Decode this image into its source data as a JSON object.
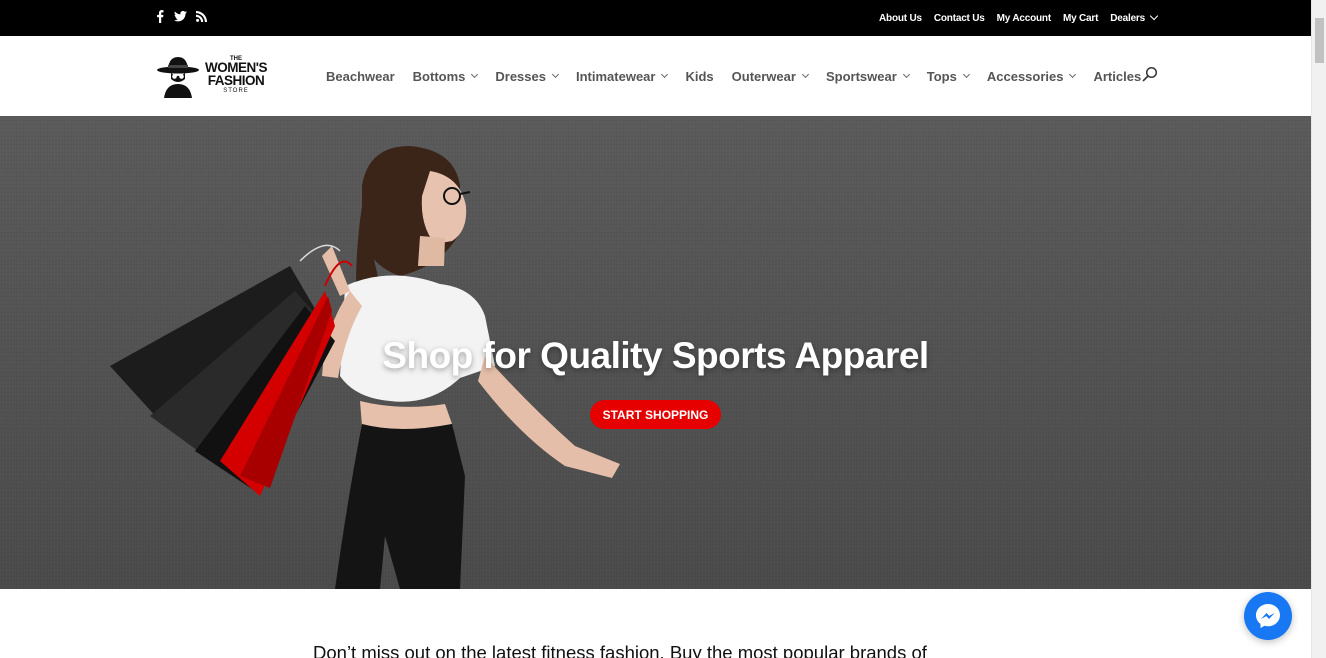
{
  "topbar": {
    "social_icons": [
      "facebook-icon",
      "twitter-icon",
      "rss-icon"
    ],
    "links": [
      {
        "label": "About Us"
      },
      {
        "label": "Contact Us"
      },
      {
        "label": "My Account"
      },
      {
        "label": "My Cart"
      },
      {
        "label": "Dealers"
      }
    ]
  },
  "logo": {
    "line1": "THE",
    "line2": "WOMEN'S",
    "line3": "FASHION",
    "line4": "STORE"
  },
  "nav": {
    "items": [
      {
        "label": "Beachwear",
        "dropdown": false
      },
      {
        "label": "Bottoms",
        "dropdown": true
      },
      {
        "label": "Dresses",
        "dropdown": true
      },
      {
        "label": "Intimatewear",
        "dropdown": true
      },
      {
        "label": "Kids",
        "dropdown": false
      },
      {
        "label": "Outerwear",
        "dropdown": true
      },
      {
        "label": "Sportswear",
        "dropdown": true
      },
      {
        "label": "Tops",
        "dropdown": true
      },
      {
        "label": "Accessories",
        "dropdown": true
      },
      {
        "label": "Articles",
        "dropdown": false
      }
    ],
    "search_icon": "search-icon"
  },
  "hero": {
    "title": "Shop for Quality Sports Apparel",
    "button_label": "START SHOPPING"
  },
  "content": {
    "intro": "Don’t miss out on the latest fitness fashion. Buy the most popular brands of"
  },
  "colors": {
    "accent": "#e60000",
    "topbar": "#000000",
    "messenger": "#1877f2"
  }
}
